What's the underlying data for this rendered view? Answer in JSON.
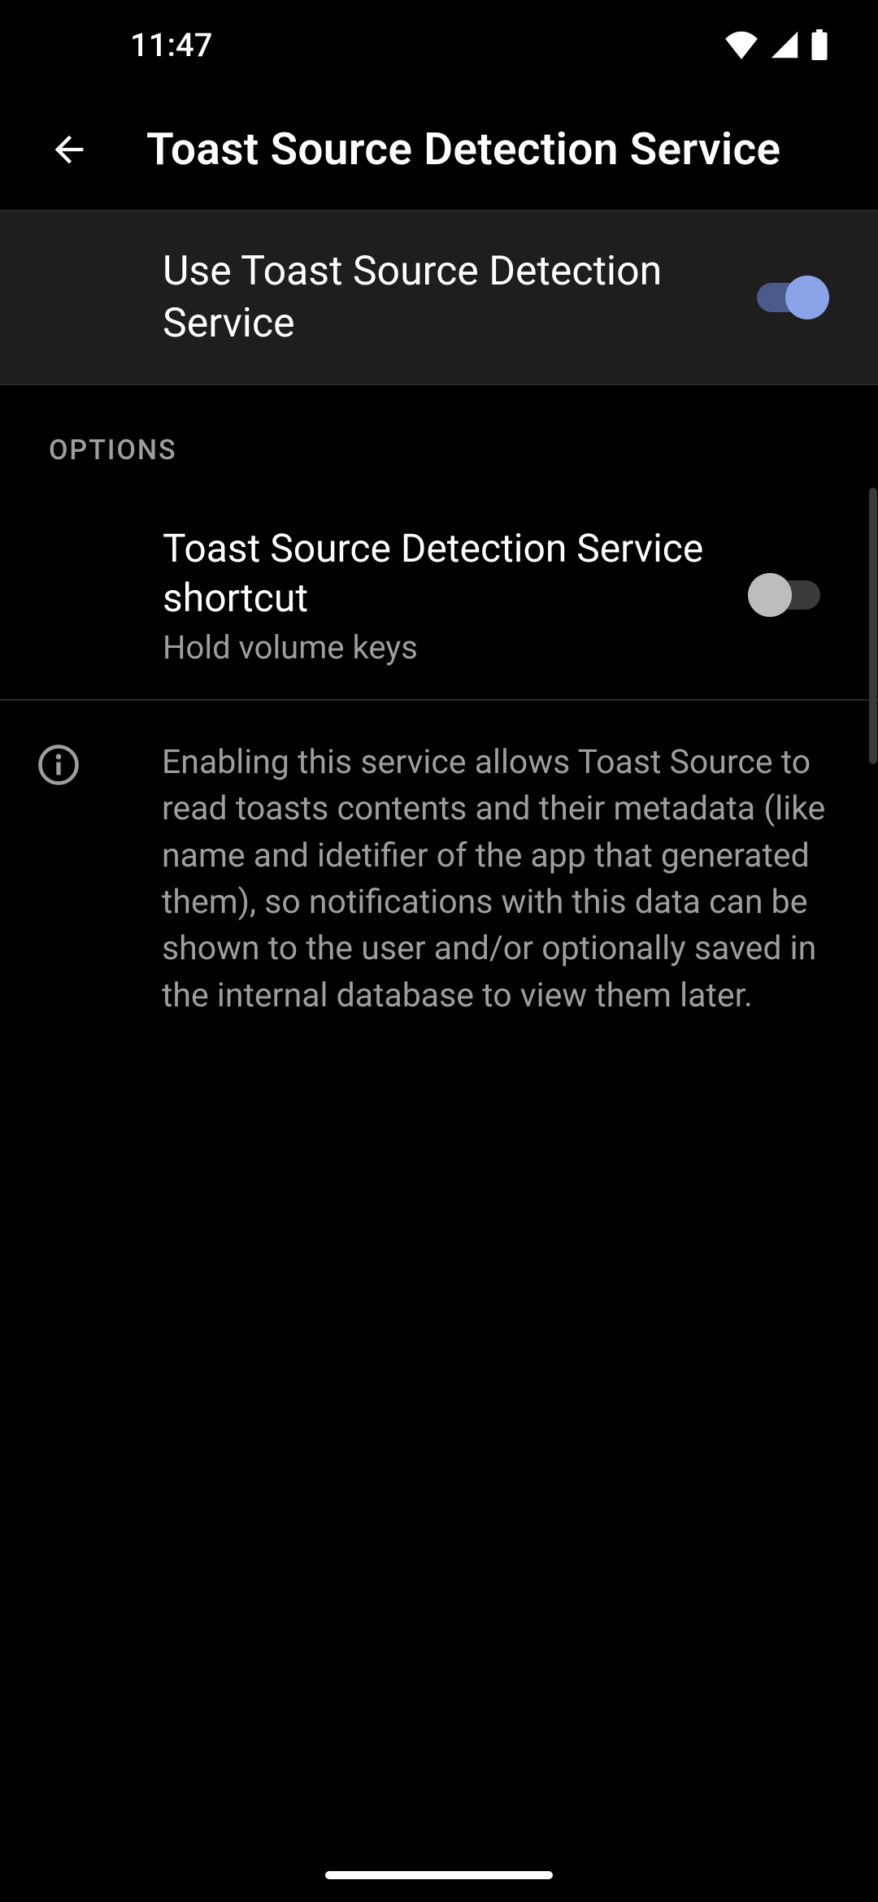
{
  "statusBar": {
    "time": "11:47"
  },
  "header": {
    "title": "Toast Source Detection Service"
  },
  "mainToggle": {
    "label": "Use Toast Source Detection Service",
    "enabled": true
  },
  "optionsSection": {
    "header": "OPTIONS",
    "shortcut": {
      "title": "Toast Source Detection Service shortcut",
      "subtitle": "Hold volume keys",
      "enabled": false
    }
  },
  "info": {
    "text": "Enabling this service allows Toast Source to read toasts contents and their metadata (like name and idetifier of the app that generated them), so notifications with this data can be shown to the user and/or optionally saved in the internal database to view them later."
  }
}
